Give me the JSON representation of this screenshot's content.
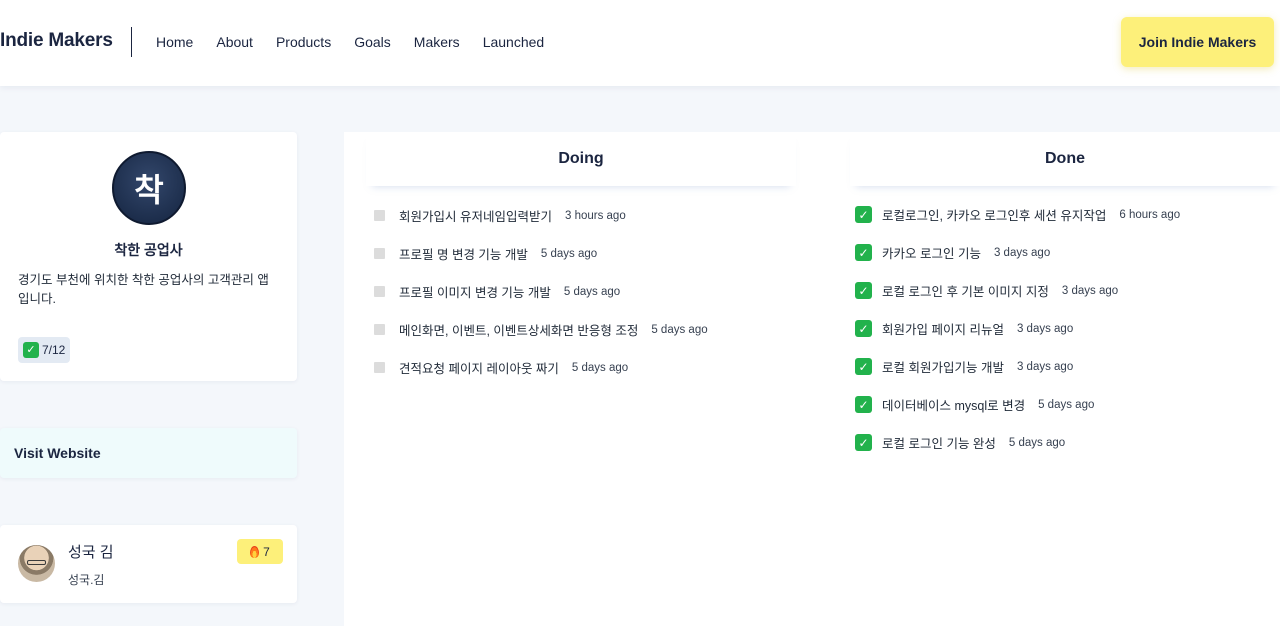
{
  "header": {
    "brand": "Indie Makers",
    "nav": [
      "Home",
      "About",
      "Products",
      "Goals",
      "Makers",
      "Launched"
    ],
    "join_button": "Join Indie Makers"
  },
  "product": {
    "logo_char": "착",
    "name": "착한 공업사",
    "description": "경기도 부천에 위치한 착한 공업사의 고객관리 앱입니다.",
    "progress": "7/12"
  },
  "visit_website": "Visit Website",
  "maker": {
    "name": "성국 김",
    "handle": "성국.김",
    "streak": "7"
  },
  "doing": {
    "title": "Doing",
    "tasks": [
      {
        "text": "회원가입시 유저네임입력받기",
        "time": "3 hours ago"
      },
      {
        "text": "프로필 명 변경 기능 개발",
        "time": "5 days ago"
      },
      {
        "text": "프로필 이미지 변경 기능 개발",
        "time": "5 days ago"
      },
      {
        "text": "메인화면, 이벤트, 이벤트상세화면 반응형 조정",
        "time": "5 days ago"
      },
      {
        "text": "견적요청 페이지 레이아웃 짜기",
        "time": "5 days ago"
      }
    ]
  },
  "done": {
    "title": "Done",
    "tasks": [
      {
        "text": "로컬로그인, 카카오 로그인후 세션 유지작업",
        "time": "6 hours ago"
      },
      {
        "text": "카카오 로그인 기능",
        "time": "3 days ago"
      },
      {
        "text": "로컬 로그인 후 기본 이미지 지정",
        "time": "3 days ago"
      },
      {
        "text": "회원가입 페이지 리뉴얼",
        "time": "3 days ago"
      },
      {
        "text": "로컬 회원가입기능 개발",
        "time": "3 days ago"
      },
      {
        "text": "데이터베이스 mysql로 변경",
        "time": "5 days ago"
      },
      {
        "text": "로컬 로그인 기능 완성",
        "time": "5 days ago"
      }
    ]
  }
}
